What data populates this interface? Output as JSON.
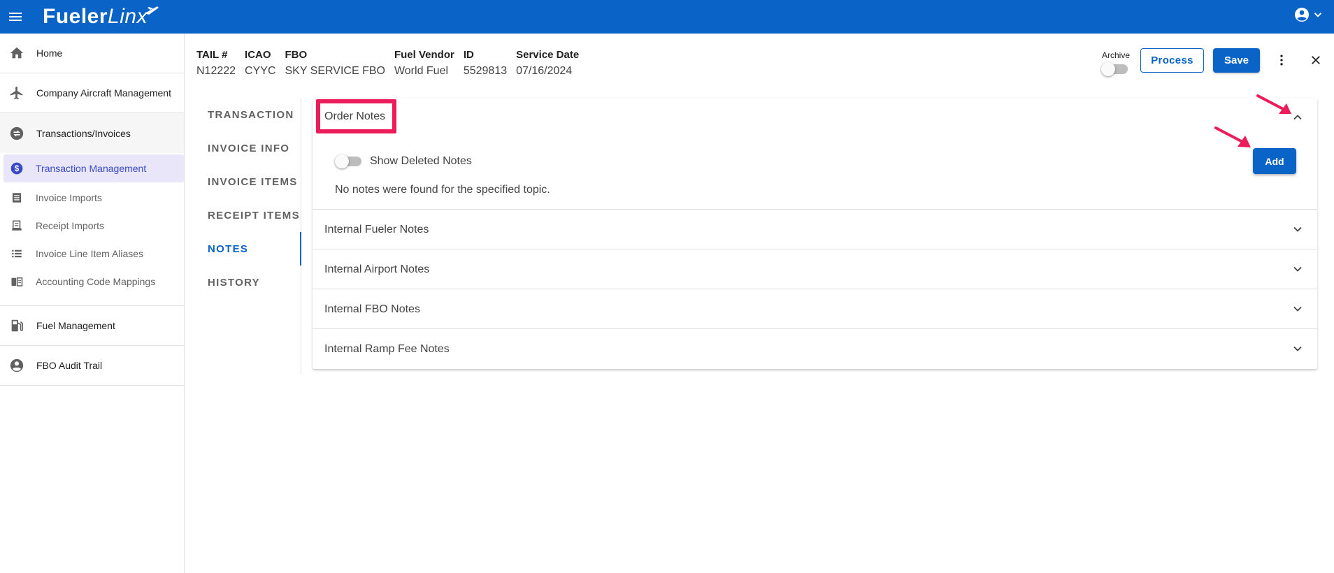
{
  "app": {
    "logo_main": "Fueler",
    "logo_sub": "Linx"
  },
  "sidebar": {
    "items": [
      {
        "label": "Home",
        "icon": "home-icon"
      },
      {
        "label": "Company Aircraft Management",
        "icon": "airplane-icon"
      },
      {
        "label": "Transactions/Invoices",
        "icon": "swap-icon"
      },
      {
        "label": "Transaction Management",
        "icon": "dollar-icon",
        "active": true
      },
      {
        "label": "Invoice Imports",
        "icon": "document-icon"
      },
      {
        "label": "Receipt Imports",
        "icon": "receipt-icon"
      },
      {
        "label": "Invoice Line Item Aliases",
        "icon": "list-icon"
      },
      {
        "label": "Accounting Code Mappings",
        "icon": "book-icon"
      },
      {
        "label": "Fuel Management",
        "icon": "fuel-pump-icon"
      },
      {
        "label": "FBO Audit Trail",
        "icon": "account-circle-icon"
      }
    ]
  },
  "header": {
    "columns": [
      {
        "label": "TAIL #",
        "value": "N12222"
      },
      {
        "label": "ICAO",
        "value": "CYYC"
      },
      {
        "label": "FBO",
        "value": "SKY SERVICE FBO"
      },
      {
        "label": "Fuel Vendor",
        "value": "World Fuel"
      },
      {
        "label": "ID",
        "value": "5529813"
      },
      {
        "label": "Service Date",
        "value": "07/16/2024"
      }
    ],
    "archive_label": "Archive",
    "process_label": "Process",
    "save_label": "Save"
  },
  "tabs": [
    {
      "label": "TRANSACTION"
    },
    {
      "label": "INVOICE INFO"
    },
    {
      "label": "INVOICE ITEMS"
    },
    {
      "label": "RECEIPT ITEMS"
    },
    {
      "label": "NOTES",
      "active": true
    },
    {
      "label": "HISTORY"
    }
  ],
  "notes": {
    "order_notes_title": "Order Notes",
    "show_deleted_label": "Show Deleted Notes",
    "empty_message": "No notes were found for the specified topic.",
    "add_label": "Add",
    "sections": [
      {
        "title": "Internal Fueler Notes"
      },
      {
        "title": "Internal Airport Notes"
      },
      {
        "title": "Internal FBO Notes"
      },
      {
        "title": "Internal Ramp Fee Notes"
      }
    ]
  },
  "colors": {
    "brand": "#0a64c8",
    "highlight": "#ec1c5a",
    "active_nav_bg": "#e8e6f8",
    "active_nav_text": "#3a49c8"
  }
}
